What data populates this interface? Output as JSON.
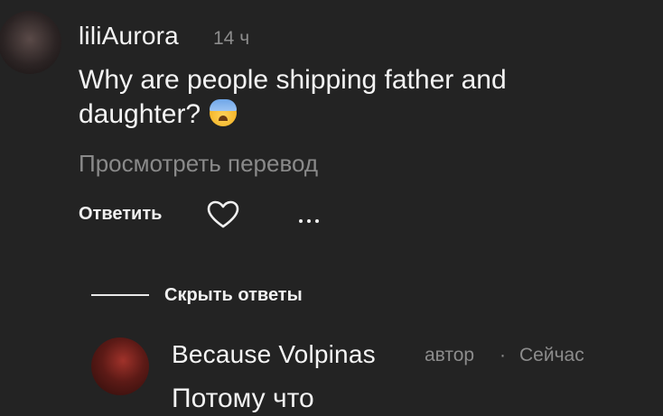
{
  "comment": {
    "username": "liliAurora",
    "time": "14 ч",
    "text_line1": "Why are people shipping father and",
    "text_line2": "daughter?",
    "emoji": "anxious-face-with-sweat",
    "translate": "Просмотреть перевод",
    "reply_label": "Ответить"
  },
  "thread": {
    "hide_replies": "Скрыть ответы"
  },
  "reply": {
    "username": "Because Volpinas",
    "author_badge": "автор",
    "separator": "·",
    "time": "Сейчас",
    "text": "Потому что"
  }
}
